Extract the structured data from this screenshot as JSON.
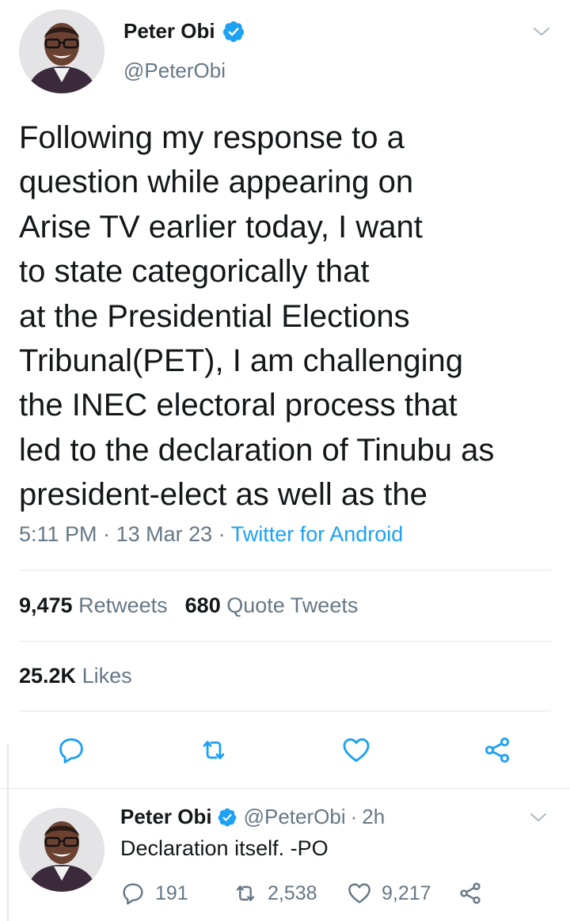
{
  "tweet": {
    "display_name": "Peter Obi",
    "handle": "@PeterObi",
    "text": "Following my response to a\nquestion while appearing on\nArise TV earlier today, I want\nto state categorically that\nat the Presidential Elections\nTribunal(PET), I am challenging\nthe INEC electoral process that\nled to the declaration of Tinubu as\npresident-elect as well as the",
    "time": "5:11 PM",
    "date": "13 Mar 23",
    "source": "Twitter for Android",
    "retweets_count": "9,475",
    "retweets_label": "Retweets",
    "quotes_count": "680",
    "quotes_label": "Quote Tweets",
    "likes_count": "25.2K",
    "likes_label": "Likes",
    "actions": [
      "reply-icon",
      "retweet-icon",
      "like-icon",
      "share-icon"
    ]
  },
  "reply": {
    "display_name": "Peter Obi",
    "handle": "@PeterObi",
    "age": "2h",
    "text": "Declaration itself. -PO",
    "reply_count": "191",
    "retweet_count": "2,538",
    "like_count": "9,217"
  },
  "colors": {
    "accent": "#1da1f2",
    "secondary_text": "#657786",
    "primary_text": "#14171a",
    "divider": "#e1e8ed"
  }
}
